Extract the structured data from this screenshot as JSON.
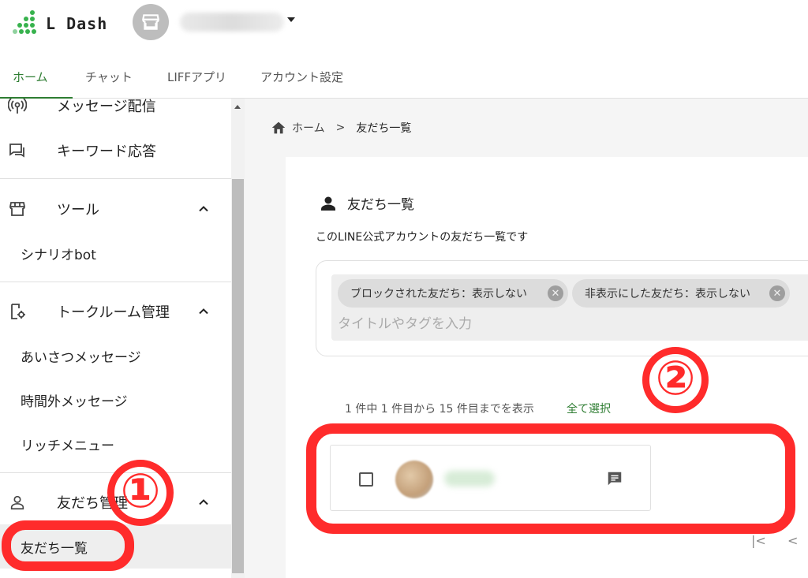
{
  "header": {
    "logo_text": "L Dash"
  },
  "tabs": [
    {
      "label": "ホーム"
    },
    {
      "label": "チャット"
    },
    {
      "label": "LIFFアプリ"
    },
    {
      "label": "アカウント設定"
    }
  ],
  "sidebar": {
    "items": [
      {
        "label": "メッセージ配信",
        "icon": "broadcast-icon"
      },
      {
        "label": "キーワード応答",
        "icon": "chat-reply-icon"
      },
      {
        "label": "ツール",
        "icon": "store-icon"
      },
      {
        "label": "シナリオbot"
      },
      {
        "label": "トークルーム管理",
        "icon": "room-settings-icon"
      },
      {
        "label": "あいさつメッセージ"
      },
      {
        "label": "時間外メッセージ"
      },
      {
        "label": "リッチメニュー"
      },
      {
        "label": "友だち管理",
        "icon": "person-icon"
      },
      {
        "label": "友だち一覧"
      }
    ]
  },
  "breadcrumb": {
    "home": "ホーム",
    "separator": ">",
    "current": "友だち一覧"
  },
  "main": {
    "title": "友だち一覧",
    "description": "このLINE公式アカウントの友だち一覧です",
    "filter_chips": [
      {
        "label": "ブロックされた友だち：表示しない"
      },
      {
        "label": "非表示にした友だち：表示しない"
      }
    ],
    "tag_input_placeholder": "タイトルやタグを入力",
    "count_text": "1 件中 1 件目から 15 件目までを表示",
    "select_all": "全て選択",
    "pager": {
      "first": "|<",
      "prev": "<"
    }
  },
  "annotations": {
    "marker_1": "①",
    "marker_2": "②",
    "color": "#ff2b2b"
  },
  "colors": {
    "accent": "#2e7d32",
    "logo_green": "#37b24d"
  }
}
